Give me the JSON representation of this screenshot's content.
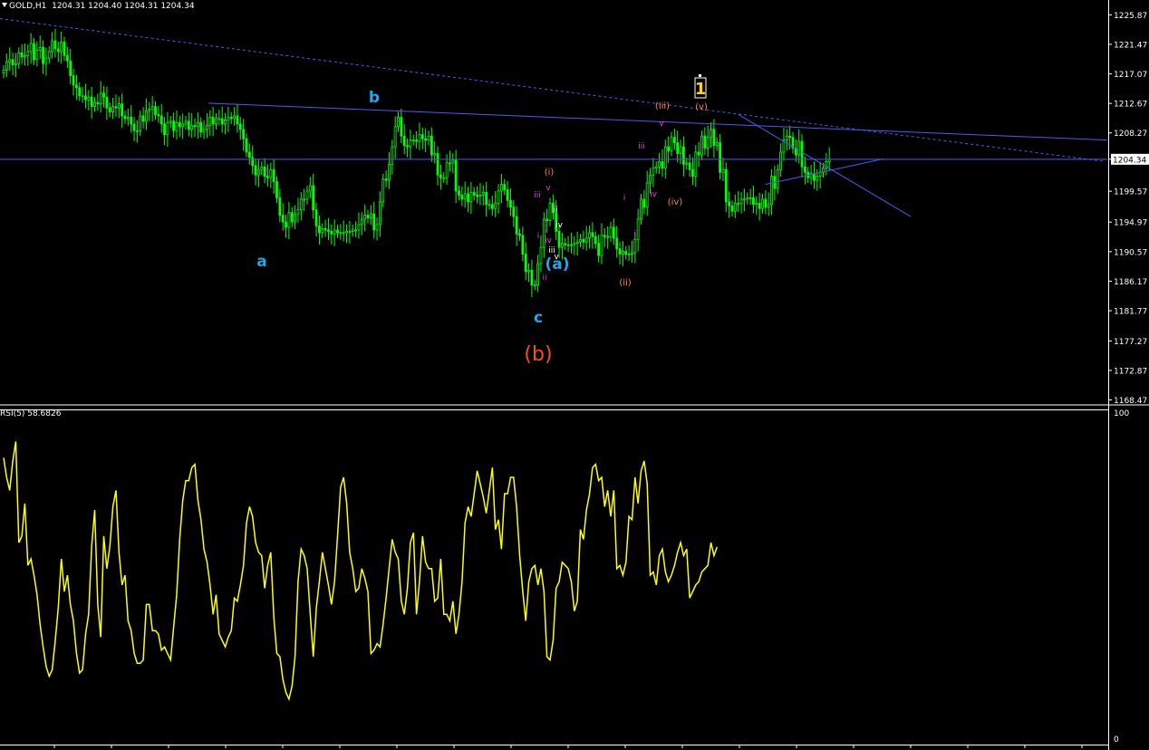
{
  "header": {
    "symbol": "GOLD,H1",
    "ohlc": "1204.31 1204.40 1204.31 1204.34",
    "rsi_label": "RSI(5) 58.6826"
  },
  "colors": {
    "background": "#000000",
    "candle": "#00ff00",
    "rsi": "#ffff00",
    "trendline": "#4a5af0",
    "grid_text": "#ffffff",
    "wave_major": "#1fa6ee",
    "wave_b": "#ff4a10",
    "wave_roman": "#ff8a3a",
    "wave_minor": "#e040e0",
    "wave_1": "#ffd700"
  },
  "chart_data": [
    {
      "type": "candlestick",
      "symbol": "GOLD",
      "timeframe": "H1",
      "current_price": "1204.34",
      "ylim": [
        1168.0,
        1227.0
      ],
      "y_ticks": [
        "1225.87",
        "1221.47",
        "1217.07",
        "1212.67",
        "1208.27",
        "1204.34",
        "1199.57",
        "1194.97",
        "1190.57",
        "1186.17",
        "1181.77",
        "1177.27",
        "1172.87",
        "1168.47"
      ],
      "y_tick_values": [
        1225.87,
        1221.47,
        1217.07,
        1212.67,
        1208.27,
        1204.34,
        1199.57,
        1194.97,
        1190.57,
        1186.17,
        1181.77,
        1177.27,
        1172.87,
        1168.47
      ],
      "close_series": [
        1217.6,
        1218.8,
        1219.2,
        1218.4,
        1218.6,
        1220.2,
        1219.6,
        1219.8,
        1220.4,
        1221.6,
        1219.2,
        1220.6,
        1221.0,
        1218.6,
        1219.4,
        1220.4,
        1222.0,
        1220.8,
        1220.4,
        1221.8,
        1219.8,
        1219.0,
        1216.8,
        1215.4,
        1215.0,
        1213.8,
        1213.8,
        1213.2,
        1213.6,
        1212.2,
        1212.8,
        1212.6,
        1214.2,
        1213.6,
        1212.0,
        1211.4,
        1212.2,
        1212.0,
        1212.6,
        1210.8,
        1210.4,
        1210.6,
        1209.6,
        1208.6,
        1208.6,
        1210.8,
        1210.0,
        1211.6,
        1211.8,
        1212.2,
        1211.0,
        1210.8,
        1209.6,
        1208.0,
        1209.8,
        1210.0,
        1208.6,
        1209.8,
        1209.2,
        1209.6,
        1210.0,
        1208.8,
        1209.4,
        1209.2,
        1209.8,
        1208.4,
        1208.8,
        1209.4,
        1210.6,
        1209.6,
        1210.4,
        1210.4,
        1209.6,
        1210.2,
        1210.6,
        1210.4,
        1210.8,
        1209.6,
        1208.8,
        1207.4,
        1205.4,
        1204.6,
        1203.4,
        1202.0,
        1202.8,
        1203.2,
        1201.8,
        1201.6,
        1202.8,
        1201.0,
        1198.6,
        1196.0,
        1195.0,
        1194.2,
        1196.4,
        1195.0,
        1196.2,
        1196.8,
        1198.4,
        1198.4,
        1199.6,
        1200.4,
        1196.8,
        1194.4,
        1193.4,
        1194.0,
        1193.8,
        1193.6,
        1193.2,
        1193.8,
        1193.4,
        1193.4,
        1193.4,
        1193.6,
        1193.6,
        1193.8,
        1193.8,
        1194.6,
        1195.4,
        1196.0,
        1195.6,
        1196.2,
        1193.8,
        1194.6,
        1198.0,
        1201.4,
        1201.2,
        1203.6,
        1206.2,
        1209.2,
        1210.6,
        1207.8,
        1206.4,
        1206.2,
        1207.2,
        1207.2,
        1207.0,
        1208.0,
        1207.4,
        1207.2,
        1207.8,
        1205.0,
        1205.2,
        1202.0,
        1201.6,
        1201.6,
        1203.8,
        1203.8,
        1204.2,
        1199.6,
        1199.0,
        1198.4,
        1199.2,
        1198.0,
        1199.4,
        1199.0,
        1198.8,
        1199.0,
        1199.4,
        1197.6,
        1197.6,
        1197.0,
        1197.8,
        1199.6,
        1200.6,
        1199.8,
        1198.2,
        1197.2,
        1195.8,
        1193.2,
        1193.0,
        1190.2,
        1187.6,
        1187.8,
        1185.6,
        1185.6,
        1188.8,
        1191.2,
        1195.4,
        1195.2,
        1197.8,
        1196.4,
        1193.6,
        1191.2,
        1191.8,
        1191.6,
        1191.6,
        1191.6,
        1191.8,
        1192.0,
        1192.4,
        1192.0,
        1192.6,
        1193.4,
        1192.8,
        1191.8,
        1190.0,
        1193.0,
        1192.8,
        1192.8,
        1194.2,
        1192.6,
        1191.0,
        1190.2,
        1190.6,
        1190.2,
        1190.2,
        1190.4,
        1192.4,
        1195.4,
        1198.4,
        1197.2,
        1200.8,
        1202.0,
        1203.0,
        1203.2,
        1204.0,
        1203.0,
        1206.2,
        1205.6,
        1207.6,
        1206.8,
        1205.2,
        1206.2,
        1203.6,
        1203.8,
        1202.8,
        1201.8,
        1205.4,
        1205.0,
        1207.8,
        1206.0,
        1207.6,
        1208.8,
        1206.4,
        1206.8,
        1202.4,
        1202.8,
        1198.0,
        1197.4,
        1196.6,
        1197.8,
        1197.8,
        1198.4,
        1198.4,
        1198.6,
        1198.6,
        1197.6,
        1197.8,
        1197.0,
        1198.4,
        1197.2,
        1197.6,
        1201.8,
        1200.0,
        1202.8,
        1205.4,
        1207.2,
        1207.8,
        1207.6,
        1206.0,
        1205.0,
        1207.0,
        1203.2,
        1202.4,
        1201.6,
        1202.2,
        1201.2,
        1201.8,
        1202.4,
        1203.0,
        1204.0,
        1204.34
      ],
      "trendlines": [
        {
          "style": "dashed",
          "from": 1225.3,
          "to": 1204.0
        },
        {
          "style": "solid",
          "from": 1212.7,
          "to": 1207.2
        },
        {
          "style": "solid-horizontal",
          "level": 1204.34
        },
        {
          "style": "solid",
          "from": 1211.0,
          "to": 1195.8
        },
        {
          "style": "solid",
          "from": 1200.6,
          "to": 1204.4
        }
      ],
      "wave_labels": [
        {
          "text": "a",
          "group": "major"
        },
        {
          "text": "b",
          "group": "major"
        },
        {
          "text": "c",
          "group": "major"
        },
        {
          "text": "(b)",
          "group": "b"
        },
        {
          "text": "1",
          "group": "one"
        },
        {
          "text": "(i)",
          "group": "roman"
        },
        {
          "text": "(ii)",
          "group": "roman"
        },
        {
          "text": "(iii)",
          "group": "roman"
        },
        {
          "text": "(iv)",
          "group": "roman"
        },
        {
          "text": "(v)",
          "group": "roman"
        },
        {
          "text": "(a)",
          "group": "major"
        },
        {
          "text": "iii",
          "group": "minor"
        },
        {
          "text": "v",
          "group": "minor"
        },
        {
          "text": "i",
          "group": "minor"
        },
        {
          "text": "ii",
          "group": "minor"
        },
        {
          "text": "iv",
          "group": "minor"
        },
        {
          "text": "ii",
          "group": "white"
        },
        {
          "text": "iv",
          "group": "white"
        },
        {
          "text": "iii",
          "group": "white"
        },
        {
          "text": "v",
          "group": "white"
        },
        {
          "text": "i",
          "group": "minor"
        },
        {
          "text": "ii",
          "group": "minor"
        },
        {
          "text": "iii",
          "group": "minor"
        },
        {
          "text": "iv",
          "group": "minor"
        },
        {
          "text": "v",
          "group": "minor"
        }
      ]
    },
    {
      "type": "line",
      "name": "RSI(5) 58.6826",
      "ylim": [
        0,
        100
      ],
      "y_ticks": [
        "100",
        "0"
      ],
      "values": [
        86,
        80,
        76,
        85,
        91,
        60,
        62,
        72,
        53,
        55,
        50,
        44,
        35,
        28,
        22,
        19,
        21,
        30,
        40,
        55,
        45,
        50,
        41,
        36,
        26,
        20,
        21,
        32,
        38,
        59,
        70,
        41,
        31,
        62,
        52,
        59,
        71,
        76,
        57,
        47,
        50,
        36,
        33,
        26,
        23,
        23,
        24,
        41,
        41,
        33,
        33,
        32,
        27,
        28,
        26,
        24,
        34,
        44,
        61,
        73,
        79,
        79,
        83,
        84,
        73,
        67,
        58,
        54,
        47,
        38,
        44,
        32,
        30,
        28,
        31,
        33,
        43,
        42,
        47,
        53,
        66,
        71,
        68,
        60,
        57,
        56,
        46,
        53,
        57,
        37,
        26,
        25,
        18,
        14,
        12,
        16,
        25,
        48,
        58,
        56,
        52,
        38,
        25,
        40,
        48,
        57,
        52,
        47,
        41,
        48,
        62,
        77,
        80,
        72,
        57,
        52,
        45,
        46,
        52,
        49,
        45,
        26,
        27,
        29,
        28,
        35,
        43,
        52,
        61,
        57,
        55,
        42,
        38,
        46,
        60,
        63,
        38,
        48,
        62,
        54,
        52,
        52,
        42,
        43,
        55,
        38,
        38,
        36,
        42,
        32,
        38,
        48,
        66,
        71,
        68,
        75,
        82,
        78,
        74,
        69,
        76,
        83,
        64,
        67,
        58,
        75,
        75,
        80,
        80,
        71,
        56,
        45,
        36,
        48,
        52,
        53,
        47,
        52,
        45,
        25,
        24,
        30,
        46,
        48,
        54,
        53,
        52,
        48,
        39,
        42,
        64,
        61,
        70,
        75,
        83,
        84,
        79,
        80,
        71,
        76,
        68,
        76,
        52,
        53,
        50,
        54,
        68,
        67,
        80,
        72,
        82,
        85,
        78,
        50,
        51,
        47,
        56,
        58,
        51,
        48,
        50,
        53,
        57,
        60,
        56,
        58,
        43,
        45,
        47,
        48,
        51,
        52,
        53,
        60,
        56,
        58.68
      ]
    }
  ]
}
